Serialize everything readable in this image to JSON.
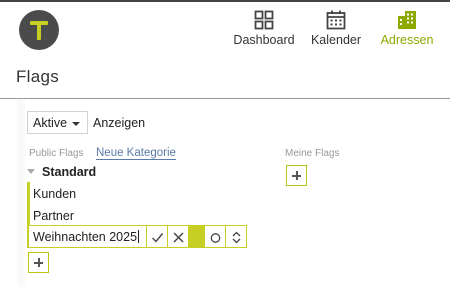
{
  "app": {
    "logo_icon": "t-logo-icon",
    "brand_color": "#c6cf24",
    "logo_bg": "#4b4b4b"
  },
  "nav": {
    "items": [
      {
        "label": "Dashboard",
        "icon": "dashboard-grid-icon",
        "active": false
      },
      {
        "label": "Kalender",
        "icon": "calendar-icon",
        "active": false
      },
      {
        "label": "Adressen",
        "icon": "buildings-icon",
        "active": true
      }
    ],
    "active_color": "#8fa800"
  },
  "page": {
    "title": "Flags"
  },
  "filter": {
    "selected": "Aktive",
    "button_label": "Anzeigen"
  },
  "public_flags": {
    "label": "Public Flags",
    "new_category_link": "Neue Kategorie",
    "category": {
      "name": "Standard",
      "items": [
        "Kunden",
        "Partner"
      ],
      "editing": {
        "value": "Weihnachten 2025",
        "actions": [
          "check-icon",
          "close-icon",
          "color-swatch",
          "circle-icon",
          "sort-icon"
        ]
      }
    },
    "add_button_icon": "plus-icon"
  },
  "my_flags": {
    "label": "Meine Flags",
    "add_button_icon": "plus-icon"
  }
}
